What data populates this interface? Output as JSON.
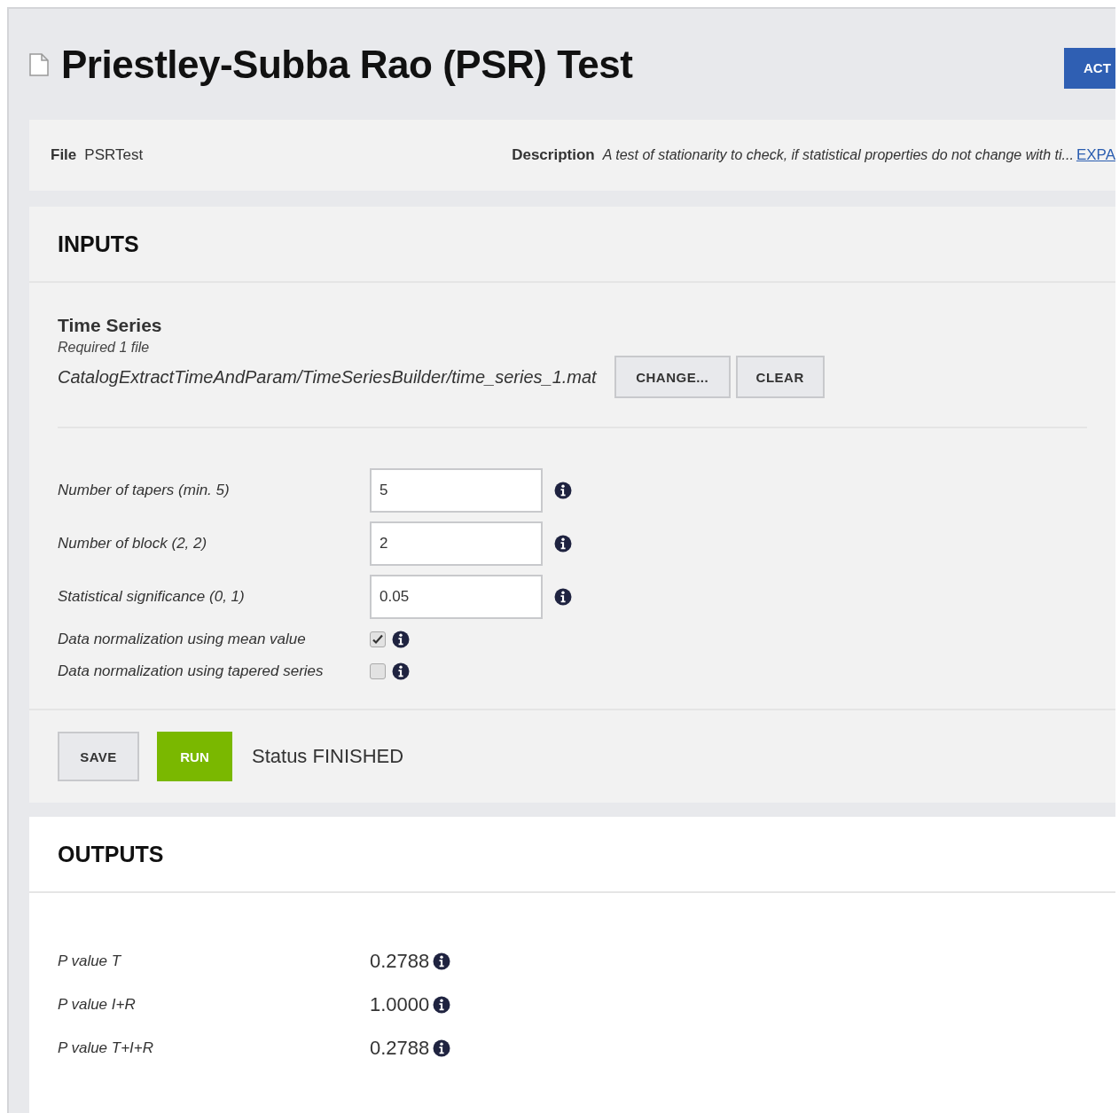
{
  "header": {
    "title": "Priestley-Subba Rao (PSR) Test",
    "action_button": "ACT"
  },
  "info_bar": {
    "file_label": "File",
    "file_value": "PSRTest",
    "description_label": "Description",
    "description_value": "A test of stationarity to check, if statistical properties do not change with ti...",
    "expand_link": "EXPA"
  },
  "inputs": {
    "title": "INPUTS",
    "time_series": {
      "label": "Time Series",
      "hint": "Required 1 file",
      "path": "CatalogExtractTimeAndParam/TimeSeriesBuilder/time_series_1.mat",
      "buttons": [
        "CHANGE...",
        "CLEAR"
      ]
    },
    "parameters": [
      {
        "kind": "number",
        "label": "Number of tapers (min. 5)",
        "value": "5"
      },
      {
        "kind": "number",
        "label": "Number of block (2, 2)",
        "value": "2"
      },
      {
        "kind": "number",
        "label": "Statistical significance (0, 1)",
        "value": "0.05"
      },
      {
        "kind": "checkbox",
        "label": "Data normalization using mean value",
        "checked": true
      },
      {
        "kind": "checkbox",
        "label": "Data normalization using tapered series",
        "checked": false
      }
    ],
    "save_button": "SAVE",
    "run_button": "RUN",
    "status": "Status FINISHED"
  },
  "outputs": {
    "title": "OUTPUTS",
    "values": [
      {
        "label": "P value T",
        "value": "0.2788"
      },
      {
        "label": "P value I+R",
        "value": "1.0000"
      },
      {
        "label": "P value T+I+R",
        "value": "0.2788"
      }
    ]
  }
}
